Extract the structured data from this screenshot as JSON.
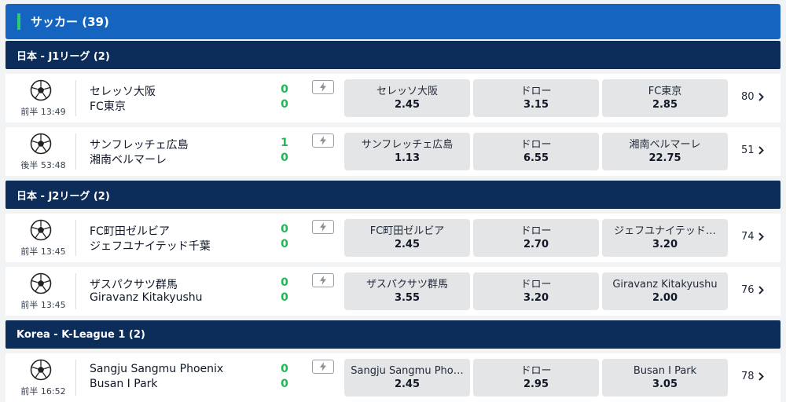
{
  "sport_header": {
    "title": "サッカー (39)"
  },
  "leagues": [
    {
      "title": "日本 - J1リーグ (2)",
      "matches": [
        {
          "status": "前半 13:49",
          "home": "セレッソ大阪",
          "away": "FC東京",
          "home_score": "0",
          "away_score": "0",
          "odds": [
            {
              "label": "セレッソ大阪",
              "price": "2.45"
            },
            {
              "label": "ドロー",
              "price": "3.15"
            },
            {
              "label": "FC東京",
              "price": "2.85"
            }
          ],
          "more": "80"
        },
        {
          "status": "後半 53:48",
          "home": "サンフレッチェ広島",
          "away": "湘南ベルマーレ",
          "home_score": "1",
          "away_score": "0",
          "odds": [
            {
              "label": "サンフレッチェ広島",
              "price": "1.13"
            },
            {
              "label": "ドロー",
              "price": "6.55"
            },
            {
              "label": "湘南ベルマーレ",
              "price": "22.75"
            }
          ],
          "more": "51"
        }
      ]
    },
    {
      "title": "日本 - J2リーグ (2)",
      "matches": [
        {
          "status": "前半 13:45",
          "home": "FC町田ゼルビア",
          "away": "ジェフユナイテッド千葉",
          "home_score": "0",
          "away_score": "0",
          "odds": [
            {
              "label": "FC町田ゼルビア",
              "price": "2.45"
            },
            {
              "label": "ドロー",
              "price": "2.70"
            },
            {
              "label": "ジェフユナイテッド…",
              "price": "3.20"
            }
          ],
          "more": "74"
        },
        {
          "status": "前半 13:45",
          "home": "ザスパクサツ群馬",
          "away": "Giravanz Kitakyushu",
          "home_score": "0",
          "away_score": "0",
          "odds": [
            {
              "label": "ザスパクサツ群馬",
              "price": "3.55"
            },
            {
              "label": "ドロー",
              "price": "3.20"
            },
            {
              "label": "Giravanz Kitakyushu",
              "price": "2.00"
            }
          ],
          "more": "76"
        }
      ]
    },
    {
      "title": "Korea - K-League 1 (2)",
      "matches": [
        {
          "status": "前半 16:52",
          "home": "Sangju Sangmu Phoenix",
          "away": "Busan I Park",
          "home_score": "0",
          "away_score": "0",
          "odds": [
            {
              "label": "Sangju Sangmu Pho…",
              "price": "2.45"
            },
            {
              "label": "ドロー",
              "price": "2.95"
            },
            {
              "label": "Busan I Park",
              "price": "3.05"
            }
          ],
          "more": "78"
        }
      ]
    }
  ],
  "colors": {
    "sport_header": "#1565c0",
    "league_header": "#0c2d5a",
    "accent_bar": "#2ecc71",
    "score": "#1db954",
    "odds_button": "#e4e5e7"
  },
  "icons": {
    "sport": "soccer-ball-icon",
    "live": "lightning-icon",
    "more": "chevron-right-icon"
  }
}
